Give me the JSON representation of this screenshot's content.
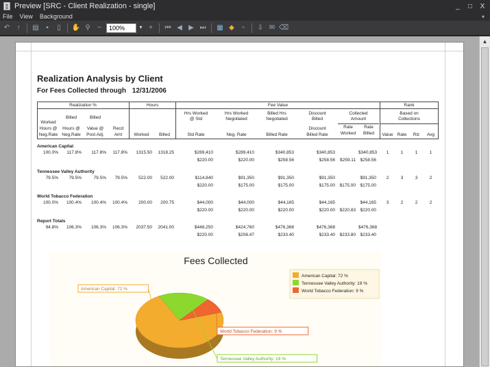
{
  "window": {
    "title": "Preview [SRC - Client Realization - single]",
    "min": "_",
    "restore": "□",
    "close": "X"
  },
  "menu": {
    "file": "File",
    "view": "View",
    "background": "Background",
    "pin": "▾"
  },
  "toolbar": {
    "zoom": "100%"
  },
  "report": {
    "title": "Realization Analysis by Client",
    "subtitle": "For Fees Collected through",
    "date": "12/31/2006",
    "groups": {
      "realization": "Realization %",
      "hours": "Hours",
      "fee_value": "Fee Value",
      "rank": "Rank"
    },
    "cols": {
      "worked_hours_neg": [
        "Worked",
        "Hours @",
        "Neg.Rate"
      ],
      "billed_hours_neg": [
        "Billed",
        "Hours @",
        "Neg.Rate"
      ],
      "billed_value_post": [
        "Billed",
        "Value @",
        "Post Adj."
      ],
      "recd_amt": [
        "Recd",
        "Amt"
      ],
      "worked": "Worked",
      "billed": "Billed",
      "hrs_worked_std": [
        "Hrs Worked",
        "@ Std"
      ],
      "std_rate": "Std Rate",
      "hrs_worked_neg": [
        "Hrs Worked",
        "Negotiated"
      ],
      "neg_rate": "Neg. Rate",
      "billed_hrs_neg": [
        "Billed Hrs",
        "Negotiated"
      ],
      "billed_rate": "Billed Rate",
      "discount_billed": [
        "Discount",
        "Billed"
      ],
      "discount_billed_rate": [
        "Discount",
        "Billed Rate"
      ],
      "collected_amount": [
        "Collected",
        "Amount"
      ],
      "rate_worked": [
        "Rate",
        "Worked"
      ],
      "rate_billed": [
        "Rate",
        "Billed"
      ],
      "based_on": [
        "Based on",
        "Collections"
      ],
      "value": "Value",
      "rate": "Rate",
      "rlz": "Rlz",
      "avg": "Avg"
    },
    "clients": [
      {
        "name": "American Capital",
        "pct": [
          "100.0%",
          "117.8%",
          "117.8%",
          "117.8%"
        ],
        "hours": [
          "1315.50",
          "1318.25"
        ],
        "fee_top": [
          "$289,410",
          "$289,410",
          "$340,853",
          "$340,853",
          "",
          "$340,853"
        ],
        "fee_bot": [
          "$220.00",
          "$220.00",
          "$258.56",
          "$258.56",
          "$259.11",
          "$258.56"
        ],
        "rank": [
          "1",
          "1",
          "1",
          "1"
        ]
      },
      {
        "name": "Tennessee Valley Authority",
        "pct": [
          "79.5%",
          "79.5%",
          "79.5%",
          "79.5%"
        ],
        "hours": [
          "522.00",
          "522.00"
        ],
        "fee_top": [
          "$114,840",
          "$91,350",
          "$91,350",
          "$91,350",
          "",
          "$91,350"
        ],
        "fee_bot": [
          "$220.00",
          "$175.00",
          "$175.00",
          "$175.00",
          "$175.00",
          "$175.00"
        ],
        "rank": [
          "2",
          "3",
          "3",
          "2"
        ]
      },
      {
        "name": "World Tobacco Federation",
        "pct": [
          "100.0%",
          "100.4%",
          "100.4%",
          "100.4%"
        ],
        "hours": [
          "200.00",
          "200.75"
        ],
        "fee_top": [
          "$44,000",
          "$44,000",
          "$44,165",
          "$44,165",
          "",
          "$44,165"
        ],
        "fee_bot": [
          "$220.00",
          "$220.00",
          "$220.00",
          "$220.00",
          "$220.83",
          "$220.00"
        ],
        "rank": [
          "3",
          "2",
          "2",
          "2"
        ]
      },
      {
        "name": "Report Totals",
        "pct": [
          "94.8%",
          "106.3%",
          "106.3%",
          "106.3%"
        ],
        "hours": [
          "2037.50",
          "2041.00"
        ],
        "fee_top": [
          "$448,250",
          "$424,760",
          "$476,368",
          "$476,368",
          "",
          "$476,368"
        ],
        "fee_bot": [
          "$220.00",
          "$208.47",
          "$233.40",
          "$233.40",
          "$233.80",
          "$233.40"
        ],
        "rank": [
          "",
          "",
          "",
          ""
        ]
      }
    ]
  },
  "chart_data": {
    "type": "pie",
    "title": "Fees Collected",
    "series": [
      {
        "label": "American Capital: 72 %",
        "value": 72,
        "color": "#f3ac2e"
      },
      {
        "label": "Tennessee Valley Authority: 19 %",
        "value": 19,
        "color": "#8cd82e"
      },
      {
        "label": "World Tobacco Federation: 9 %",
        "value": 9,
        "color": "#f06530"
      }
    ],
    "legend_position": "top-right"
  }
}
